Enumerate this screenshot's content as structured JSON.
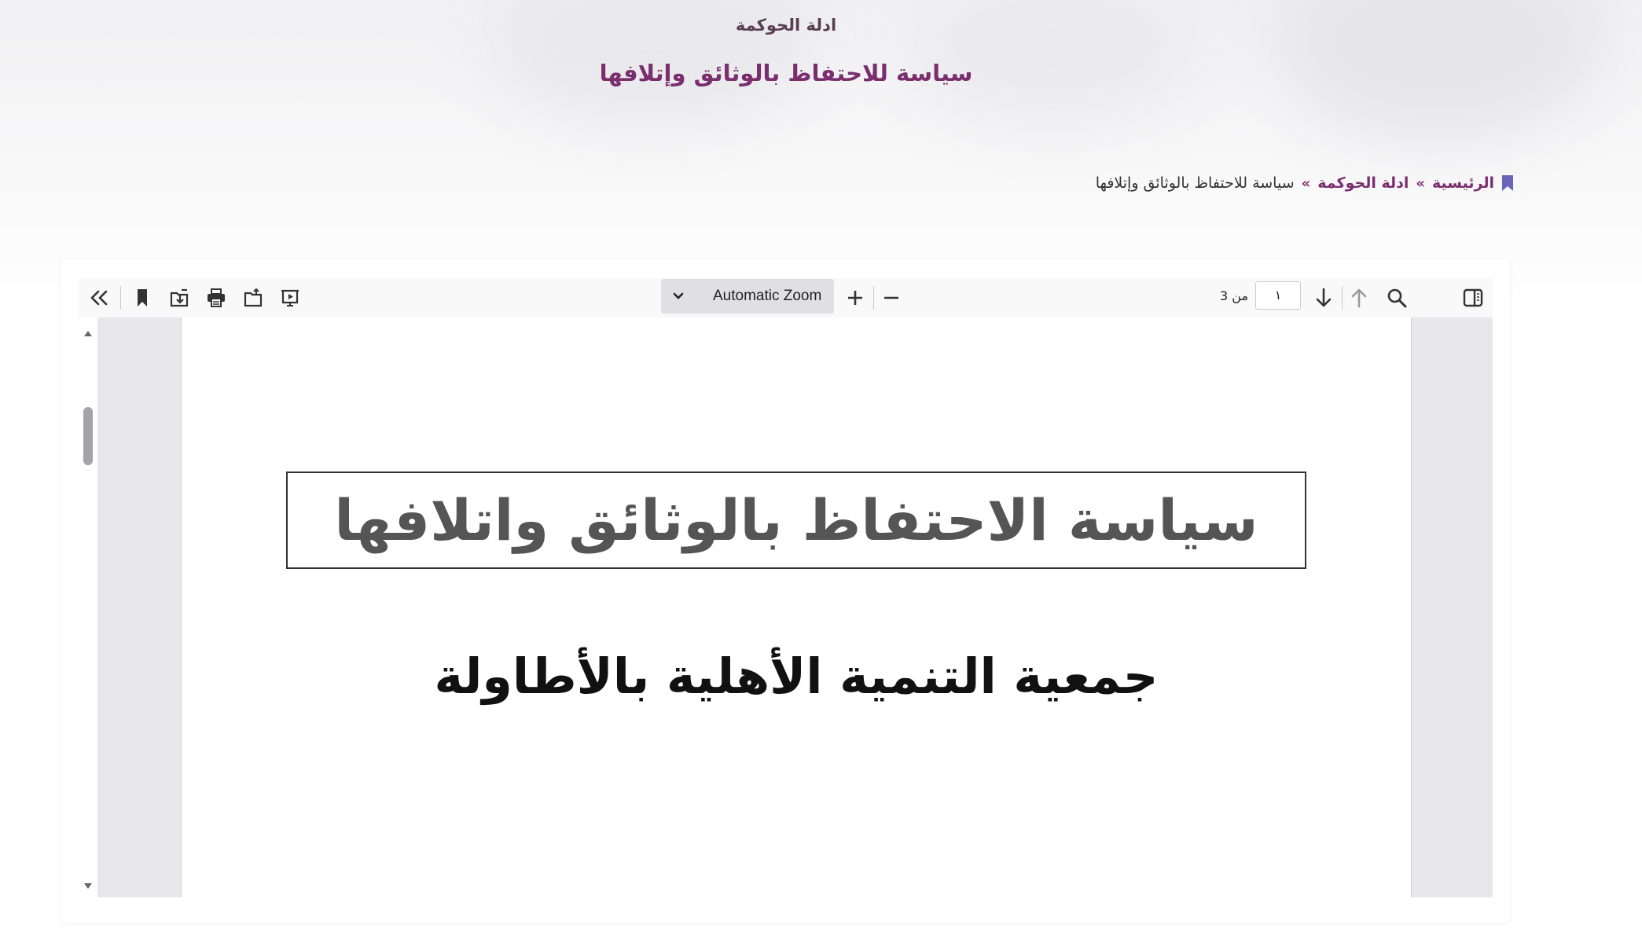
{
  "header": {
    "category": "ادلة الحوكمة",
    "title": "سياسة للاحتفاظ بالوثائق وإتلافها"
  },
  "breadcrumb": {
    "home": "الرئيسية",
    "separator": "»",
    "category": "ادلة الحوكمة",
    "current": "سياسة للاحتفاظ بالوثائق وإتلافها"
  },
  "viewer": {
    "zoom_label": "Automatic Zoom",
    "page_input_value": "١",
    "page_count_text": "من 3",
    "icons": [
      "sidebar-toggle-icon",
      "search-icon",
      "previous-page-icon",
      "next-page-icon",
      "zoom-out-icon",
      "zoom-in-icon",
      "chevron-down-icon",
      "presentation-mode-icon",
      "open-file-icon",
      "print-icon",
      "download-icon",
      "bookmark-icon",
      "tools-icon"
    ]
  },
  "document": {
    "title": "سياسة الاحتفاظ بالوثائق واتلافها",
    "subtitle": "جمعية التنمية الأهلية بالأطاولة"
  },
  "colors": {
    "accent": "#7a2e6e",
    "bookmark": "#6a64b8",
    "toolbar_bg": "#f9f9fa",
    "doc_bg": "#e8e8eb"
  }
}
